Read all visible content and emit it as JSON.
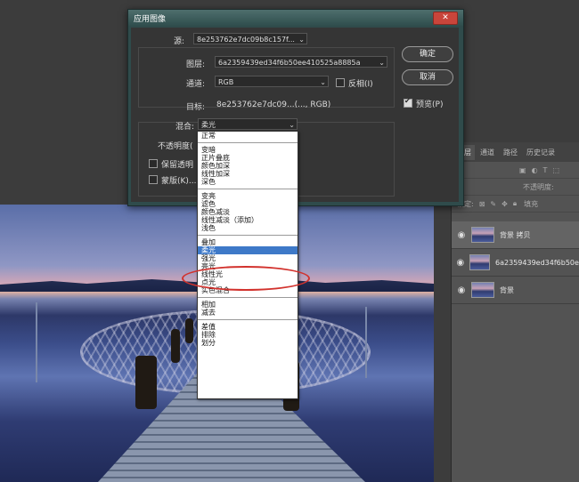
{
  "dialog": {
    "title": "应用图像",
    "close_label": "✕",
    "source_label": "源:",
    "source_value": "8e253762e7dc09b8c157f...",
    "layer_label": "图层:",
    "layer_value": "6a2359439ed34f6b50ee410525a8885a",
    "channel_label": "通道:",
    "channel_value": "RGB",
    "invert_label": "反相(I)",
    "target_label": "目标:",
    "target_value": "8e253762e7dc09...(..., RGB)",
    "blend_label": "混合:",
    "blend_value": "柔光",
    "opacity_label": "不透明度(",
    "preserve_label": "保留透明",
    "mask_label": "蒙版(K)...",
    "ok_label": "确定",
    "cancel_label": "取消",
    "preview_label": "预览(P)",
    "preview_checked": true,
    "invert_checked": false
  },
  "blend_menu": {
    "groups": [
      [
        "正常"
      ],
      [
        "变暗",
        "正片叠底",
        "颜色加深",
        "线性加深",
        "深色"
      ],
      [
        "变亮",
        "滤色",
        "颜色减淡",
        "线性减淡（添加）",
        "浅色"
      ],
      [
        "叠加",
        "柔光",
        "强光",
        "亮光",
        "线性光",
        "点光",
        "实色混合"
      ],
      [
        "相加",
        "减去"
      ],
      [
        "差值",
        "排除",
        "划分"
      ]
    ],
    "selected": "柔光"
  },
  "layers_panel": {
    "tabs": [
      "图层",
      "通道",
      "路径",
      "历史记录"
    ],
    "kind_label": "类",
    "opacity_label": "不透明度:",
    "lock_label": "锁定:",
    "fill_label": "填充",
    "layers": [
      {
        "name": "背景 拷贝",
        "selected": true
      },
      {
        "name": "6a2359439ed34f6b50ee...",
        "selected": false
      },
      {
        "name": "背景",
        "selected": false
      }
    ]
  },
  "colors": {
    "accent": "#3e79c8",
    "highlight": "#d2322d"
  }
}
